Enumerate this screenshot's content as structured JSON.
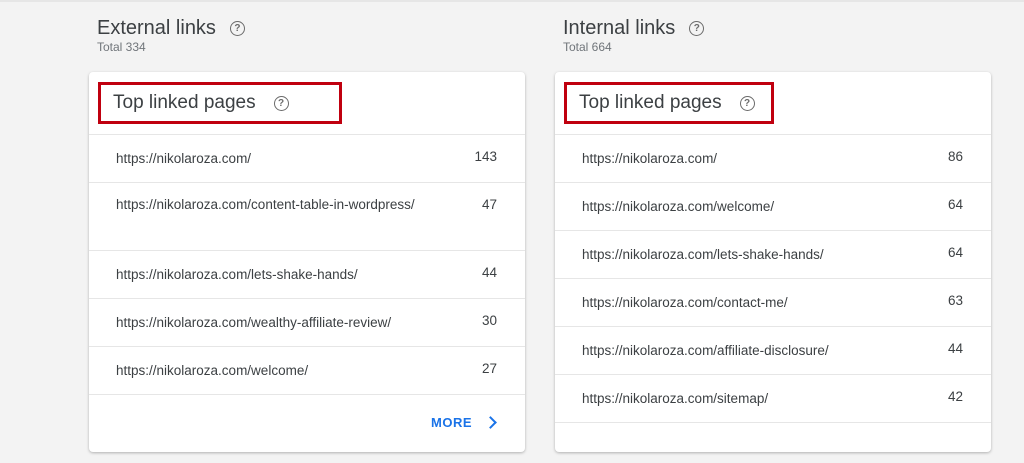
{
  "external": {
    "title": "External links",
    "total": "Total 334",
    "card_title": "Top linked pages",
    "rows": [
      {
        "url": "https://nikolaroza.com/",
        "count": "143"
      },
      {
        "url": "https://nikolaroza.com/content-table-in-wordpress/",
        "count": "47"
      },
      {
        "url": "https://nikolaroza.com/lets-shake-hands/",
        "count": "44"
      },
      {
        "url": "https://nikolaroza.com/wealthy-affiliate-review/",
        "count": "30"
      },
      {
        "url": "https://nikolaroza.com/welcome/",
        "count": "27"
      }
    ],
    "more_label": "MORE"
  },
  "internal": {
    "title": "Internal links",
    "total": "Total 664",
    "card_title": "Top linked pages",
    "rows": [
      {
        "url": "https://nikolaroza.com/",
        "count": "86"
      },
      {
        "url": "https://nikolaroza.com/welcome/",
        "count": "64"
      },
      {
        "url": "https://nikolaroza.com/lets-shake-hands/",
        "count": "64"
      },
      {
        "url": "https://nikolaroza.com/contact-me/",
        "count": "63"
      },
      {
        "url": "https://nikolaroza.com/affiliate-disclosure/",
        "count": "44"
      },
      {
        "url": "https://nikolaroza.com/sitemap/",
        "count": "42"
      }
    ]
  },
  "colors": {
    "highlight": "#c0000f",
    "link": "#1a73e8"
  }
}
